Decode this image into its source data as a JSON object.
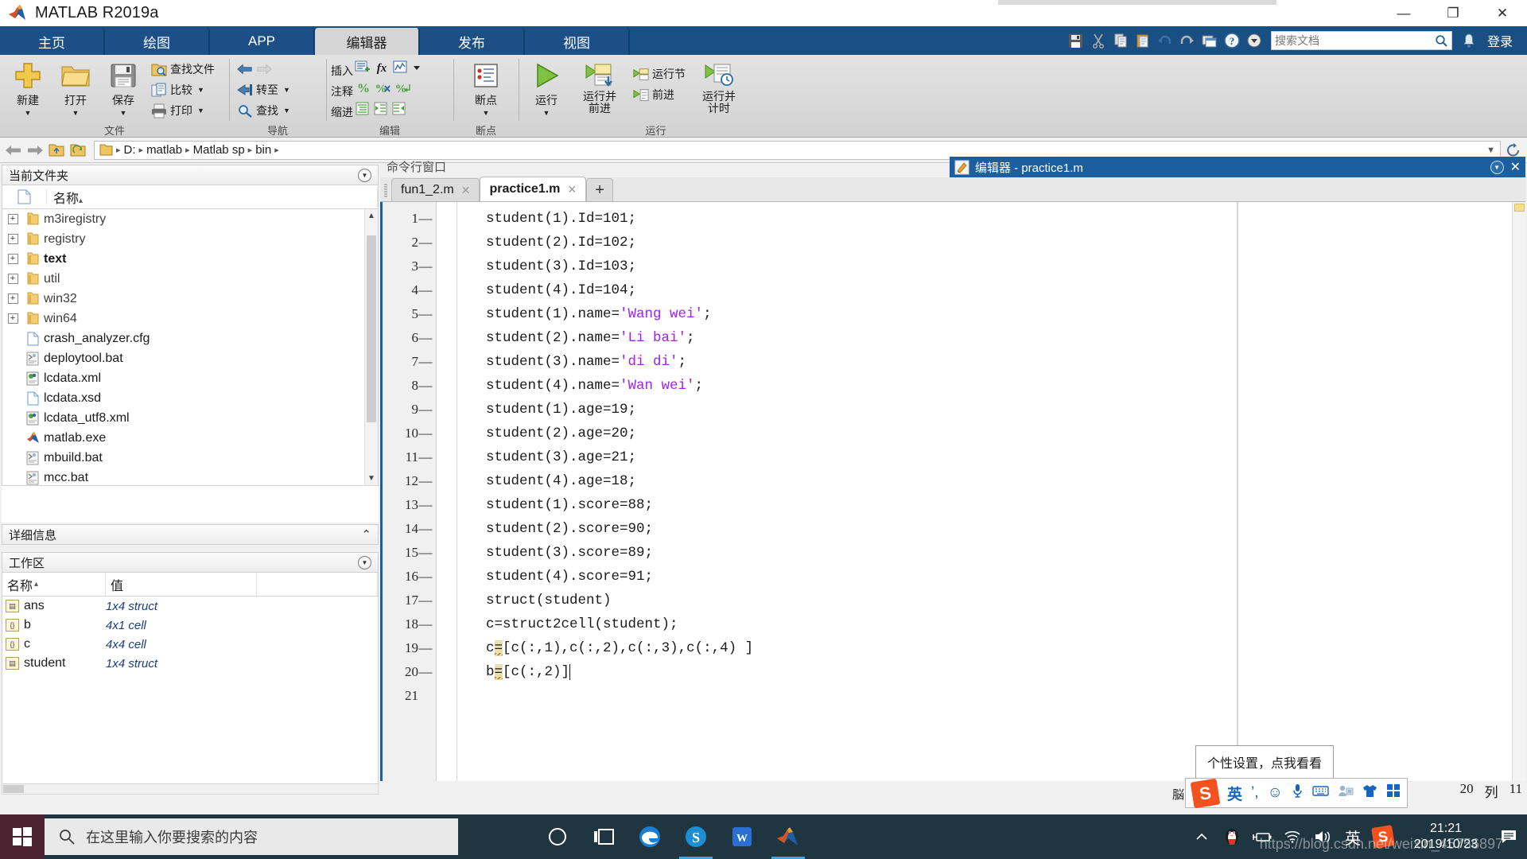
{
  "window": {
    "title": "MATLAB R2019a",
    "minimize": "—",
    "maximize": "❐",
    "close": "✕"
  },
  "ribbon": {
    "tabs": [
      {
        "label": "主页",
        "active": false
      },
      {
        "label": "绘图",
        "active": false
      },
      {
        "label": "APP",
        "active": false
      },
      {
        "label": "编辑器",
        "active": true
      },
      {
        "label": "发布",
        "active": false
      },
      {
        "label": "视图",
        "active": false
      }
    ],
    "quick_access": [
      "save-icon",
      "cut-icon",
      "copy-icon",
      "paste-icon",
      "undo-icon",
      "redo-icon",
      "layout-icon",
      "help-icon",
      "dropdown-icon"
    ],
    "search": {
      "placeholder": "搜索文档",
      "value": ""
    },
    "login_label": "登录",
    "groups": [
      {
        "name": "文件",
        "big_buttons": [
          {
            "label": "新建",
            "icon": "new-plus-icon",
            "caret": "▼"
          },
          {
            "label": "打开",
            "icon": "open-folder-icon",
            "caret": "▼"
          },
          {
            "label": "保存",
            "icon": "save-floppy-icon",
            "caret": "▼"
          }
        ],
        "small_buttons": [
          {
            "label": "查找文件",
            "icon": "find-files-icon",
            "caret": ""
          },
          {
            "label": "比较",
            "icon": "compare-icon",
            "caret": "▼"
          },
          {
            "label": "打印",
            "icon": "print-icon",
            "caret": "▼"
          }
        ]
      },
      {
        "name": "导航",
        "small_buttons": [
          {
            "label": "",
            "icon": "back-arrow-icon",
            "caret": ""
          },
          {
            "label": "转至",
            "icon": "goto-icon",
            "caret": "▼"
          },
          {
            "label": "查找",
            "icon": "search-magnifier-icon",
            "caret": "▼"
          }
        ]
      },
      {
        "name": "编辑",
        "rows": [
          {
            "label": "插入",
            "icons": [
              "insert-section-icon",
              "insert-function-icon",
              "insert-figure-icon",
              "dropdown-caret-icon"
            ]
          },
          {
            "label": "注释",
            "icons": [
              "comment-icon",
              "uncomment-icon",
              "wrap-comment-icon"
            ]
          },
          {
            "label": "缩进",
            "icons": [
              "smart-indent-icon",
              "indent-right-icon",
              "indent-left-icon"
            ]
          }
        ]
      },
      {
        "name": "断点",
        "big_buttons": [
          {
            "label": "断点",
            "icon": "breakpoint-icon",
            "caret": "▼"
          }
        ]
      },
      {
        "name": "运行",
        "big_buttons": [
          {
            "label": "运行",
            "icon": "run-play-icon",
            "caret": "▼"
          },
          {
            "label": "运行并",
            "label2": "前进",
            "icon": "run-advance-icon",
            "caret": ""
          },
          {
            "label": "运行节",
            "icon": "run-section-icon",
            "caret": "",
            "small": true
          },
          {
            "label": "前进",
            "icon": "advance-icon",
            "caret": "",
            "small": true
          },
          {
            "label": "运行并",
            "label2": "计时",
            "icon": "run-time-icon",
            "caret": ""
          }
        ]
      }
    ]
  },
  "address_bar": {
    "back_icon": "back-arrow-icon",
    "forward_icon": "forward-arrow-icon",
    "up_icon": "folder-up-icon",
    "browse_icon": "browse-folder-icon",
    "folder_icon": "folder-icon",
    "crumbs": [
      "D:",
      "matlab",
      "Matlab sp",
      "bin"
    ],
    "separator": "▸",
    "caret": "▼",
    "refresh_icon": "refresh-icon"
  },
  "current_folder": {
    "title": "当前文件夹",
    "columns": {
      "icon": "file-icon",
      "name": "名称",
      "sort": "▴"
    },
    "items": [
      {
        "name": "m3iregistry",
        "type": "folder",
        "expandable": true,
        "bold": false
      },
      {
        "name": "registry",
        "type": "folder",
        "expandable": true,
        "bold": false
      },
      {
        "name": "text",
        "type": "folder",
        "expandable": true,
        "bold": true
      },
      {
        "name": "util",
        "type": "folder",
        "expandable": true,
        "bold": false
      },
      {
        "name": "win32",
        "type": "folder",
        "expandable": true,
        "bold": false
      },
      {
        "name": "win64",
        "type": "folder",
        "expandable": true,
        "bold": false
      },
      {
        "name": "crash_analyzer.cfg",
        "type": "file",
        "expandable": false,
        "bold": false
      },
      {
        "name": "deploytool.bat",
        "type": "bat",
        "expandable": false,
        "bold": false
      },
      {
        "name": "lcdata.xml",
        "type": "xml",
        "expandable": false,
        "bold": false
      },
      {
        "name": "lcdata.xsd",
        "type": "file",
        "expandable": false,
        "bold": false
      },
      {
        "name": "lcdata_utf8.xml",
        "type": "xml",
        "expandable": false,
        "bold": false
      },
      {
        "name": "matlab.exe",
        "type": "exe",
        "expandable": false,
        "bold": false
      },
      {
        "name": "mbuild.bat",
        "type": "bat",
        "expandable": false,
        "bold": false
      },
      {
        "name": "mcc.bat",
        "type": "bat",
        "expandable": false,
        "bold": false
      }
    ]
  },
  "details_panel": {
    "title": "详细信息",
    "collapse": "⌃"
  },
  "workspace": {
    "title": "工作区",
    "columns": [
      "名称",
      "值",
      ""
    ],
    "sort": "▴",
    "rows": [
      {
        "name": "ans",
        "value": "1x4 struct",
        "kind": "struct"
      },
      {
        "name": "b",
        "value": "4x1 cell",
        "kind": "cell"
      },
      {
        "name": "c",
        "value": "4x4 cell",
        "kind": "cell"
      },
      {
        "name": "student",
        "value": "1x4 struct",
        "kind": "struct"
      }
    ]
  },
  "command_window": {
    "title": "命令行窗口"
  },
  "editor": {
    "title": "编辑器 - practice1.m",
    "title_icon": "editor-pencil-icon",
    "collapse_icon": "dropdown-icon",
    "close_icon": "✕",
    "tabs": [
      {
        "label": "fun1_2.m",
        "active": false,
        "close": "✕"
      },
      {
        "label": "practice1.m",
        "active": true,
        "close": "✕"
      }
    ],
    "new_tab": "+",
    "lines": [
      {
        "n": "1",
        "dash": "—",
        "parts": [
          {
            "t": "student(1).Id=101;"
          }
        ]
      },
      {
        "n": "2",
        "dash": "—",
        "parts": [
          {
            "t": "student(2).Id=102;"
          }
        ]
      },
      {
        "n": "3",
        "dash": "—",
        "parts": [
          {
            "t": "student(3).Id=103;"
          }
        ]
      },
      {
        "n": "4",
        "dash": "—",
        "parts": [
          {
            "t": "student(4).Id=104;"
          }
        ]
      },
      {
        "n": "5",
        "dash": "—",
        "parts": [
          {
            "t": "student(1).name="
          },
          {
            "t": "'Wang wei'",
            "s": "str"
          },
          {
            "t": ";"
          }
        ]
      },
      {
        "n": "6",
        "dash": "—",
        "parts": [
          {
            "t": "student(2).name="
          },
          {
            "t": "'Li bai'",
            "s": "str"
          },
          {
            "t": ";"
          }
        ]
      },
      {
        "n": "7",
        "dash": "—",
        "parts": [
          {
            "t": "student(3).name="
          },
          {
            "t": "'di di'",
            "s": "str"
          },
          {
            "t": ";"
          }
        ]
      },
      {
        "n": "8",
        "dash": "—",
        "parts": [
          {
            "t": "student(4).name="
          },
          {
            "t": "'Wan wei'",
            "s": "str"
          },
          {
            "t": ";"
          }
        ]
      },
      {
        "n": "9",
        "dash": "—",
        "parts": [
          {
            "t": "student(1).age=19;"
          }
        ]
      },
      {
        "n": "10",
        "dash": "—",
        "parts": [
          {
            "t": "student(2).age=20;"
          }
        ]
      },
      {
        "n": "11",
        "dash": "—",
        "parts": [
          {
            "t": "student(3).age=21;"
          }
        ]
      },
      {
        "n": "12",
        "dash": "—",
        "parts": [
          {
            "t": "student(4).age=18;"
          }
        ]
      },
      {
        "n": "13",
        "dash": "—",
        "parts": [
          {
            "t": "student(1).score=88;"
          }
        ]
      },
      {
        "n": "14",
        "dash": "—",
        "parts": [
          {
            "t": "student(2).score=90;"
          }
        ]
      },
      {
        "n": "15",
        "dash": "—",
        "parts": [
          {
            "t": "student(3).score=89;"
          }
        ]
      },
      {
        "n": "16",
        "dash": "—",
        "parts": [
          {
            "t": "student(4).score=91;"
          }
        ]
      },
      {
        "n": "17",
        "dash": "—",
        "parts": [
          {
            "t": "struct(student)"
          }
        ]
      },
      {
        "n": "18",
        "dash": "—",
        "parts": [
          {
            "t": "c=struct2cell(student);"
          }
        ]
      },
      {
        "n": "19",
        "dash": "—",
        "parts": [
          {
            "t": "c"
          },
          {
            "t": "=",
            "s": "hl"
          },
          {
            "t": "[c(:,1),c(:,2),c(:,3),c(:,4) ]"
          }
        ]
      },
      {
        "n": "20",
        "dash": "—",
        "parts": [
          {
            "t": "b"
          },
          {
            "t": "=",
            "s": "hl"
          },
          {
            "t": "[c(:,2)]"
          },
          {
            "t": "",
            "s": "caret"
          }
        ]
      },
      {
        "n": "21",
        "dash": "",
        "parts": [
          {
            "t": ""
          }
        ]
      }
    ]
  },
  "tooltip": {
    "text": "个性设置，点我看看"
  },
  "ime": {
    "prefix": "脳",
    "logo": "S",
    "mode": "英",
    "items": [
      "punctuation-icon",
      "emoji-icon",
      "microphone-icon",
      "keyboard-icon",
      "contact-icon",
      "skin-icon",
      "apps-icon"
    ]
  },
  "status_bar": {
    "line_label": "20",
    "col_label": "列",
    "col_value": "11"
  },
  "taskbar": {
    "start_icon": "windows-start-icon",
    "search_placeholder": "在这里输入你要搜索的内容",
    "search_icon": "search-icon",
    "pinned": [
      "cortana-circle-icon",
      "task-view-icon",
      "edge-icon",
      "sogou-icon",
      "wps-icon",
      "matlab-icon"
    ],
    "tray": [
      "chevron-up-icon",
      "qq-penguin-icon",
      "battery-icon",
      "wifi-icon",
      "volume-icon"
    ],
    "tray_ime": "英",
    "tray_sogou": "S",
    "clock_time": "21:21",
    "clock_date": "2019/10/23",
    "notification_icon": "notification-icon",
    "watermark": "https://blog.csdn.net/weixin_45756897"
  }
}
